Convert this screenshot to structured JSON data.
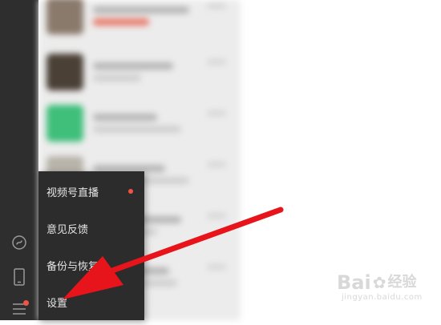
{
  "popup_menu": {
    "items": [
      {
        "label": "视频号直播",
        "has_dot": true
      },
      {
        "label": "意见反馈",
        "has_dot": false
      },
      {
        "label": "备份与恢复",
        "has_dot": false
      },
      {
        "label": "设置",
        "has_dot": false
      }
    ]
  },
  "sidebar": {
    "icons": [
      "mini-program-icon",
      "phone-icon",
      "menu-icon"
    ],
    "menu_has_notification": true
  },
  "watermark": {
    "brand_left": "Bai",
    "brand_right": "经验",
    "url": "jingyan.baidu.com"
  },
  "colors": {
    "sidebar_bg": "#2e2e2e",
    "popup_bg": "#2c2c2c",
    "notification_dot": "#ee5544",
    "arrow": "#e8141b"
  }
}
